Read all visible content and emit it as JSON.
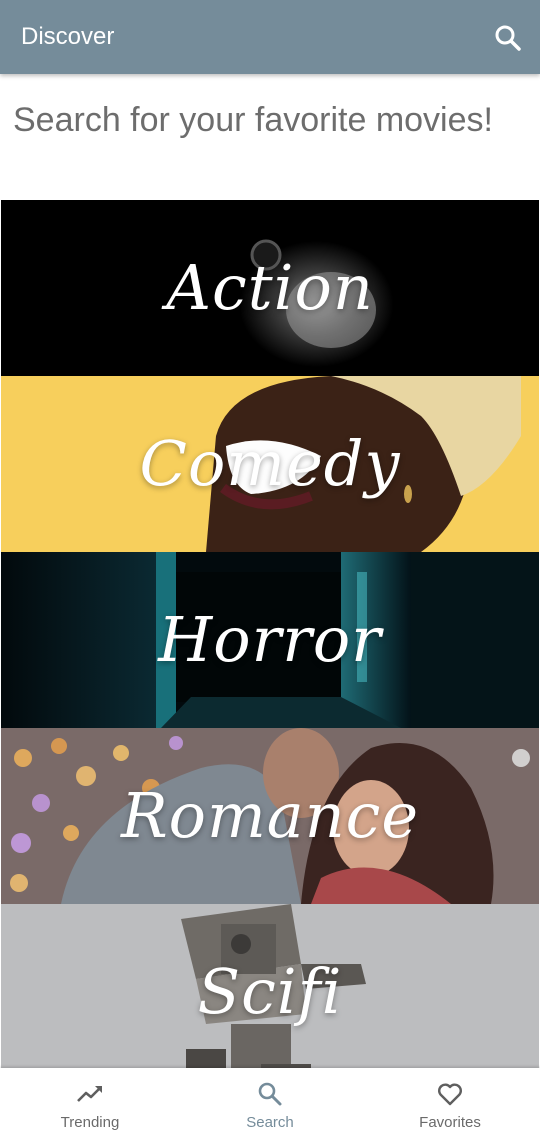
{
  "app_bar": {
    "title": "Discover",
    "search_icon": "search-icon",
    "background": "#758c9a"
  },
  "heading": "Search for your favorite movies!",
  "genres": [
    {
      "label": "Action"
    },
    {
      "label": "Comedy"
    },
    {
      "label": "Horror"
    },
    {
      "label": "Romance"
    },
    {
      "label": "Scifi"
    }
  ],
  "bottom_nav": {
    "items": [
      {
        "label": "Trending",
        "icon": "trending-up-icon",
        "active": false
      },
      {
        "label": "Search",
        "icon": "search-icon",
        "active": true
      },
      {
        "label": "Favorites",
        "icon": "heart-outline-icon",
        "active": false
      }
    ],
    "active_color": "#758c9a",
    "inactive_color": "#6a6a6a"
  }
}
